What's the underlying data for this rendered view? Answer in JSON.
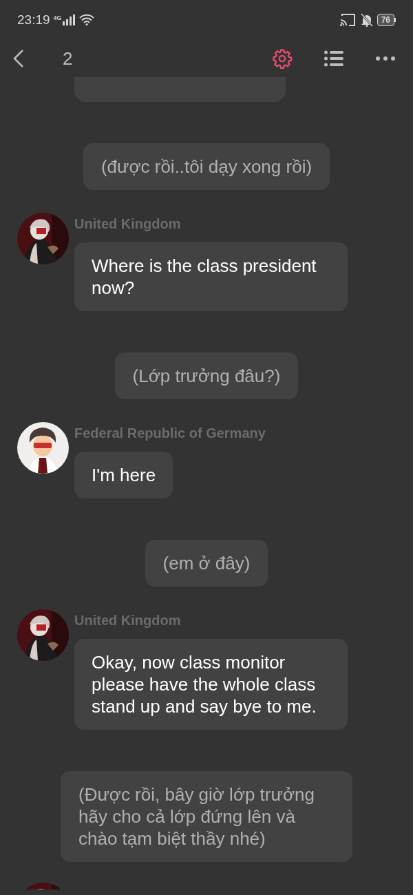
{
  "status_bar": {
    "time": "23:19",
    "network": "4G",
    "battery": "76"
  },
  "header": {
    "title": "2"
  },
  "chat": [
    {
      "kind": "partial"
    },
    {
      "kind": "narration",
      "text": "(được rồi..tôi dạy xong rồi)"
    },
    {
      "kind": "message",
      "name": "United Kingdom",
      "text": "Where is the class president now?"
    },
    {
      "kind": "narration",
      "text": "(Lớp trưởng đâu?)"
    },
    {
      "kind": "message",
      "name": "Federal Republic of Germany",
      "text": "I'm here"
    },
    {
      "kind": "narration",
      "text": "(em ở đây)"
    },
    {
      "kind": "message",
      "name": "United Kingdom",
      "text": "Okay, now class monitor please have the whole class stand up and say bye to me."
    },
    {
      "kind": "narration",
      "text": "(Được rồi, bây giờ lớp trưởng hãy cho cả lớp đứng lên và chào tạm biệt thầy nhé)"
    },
    {
      "kind": "avatar_peek"
    }
  ]
}
